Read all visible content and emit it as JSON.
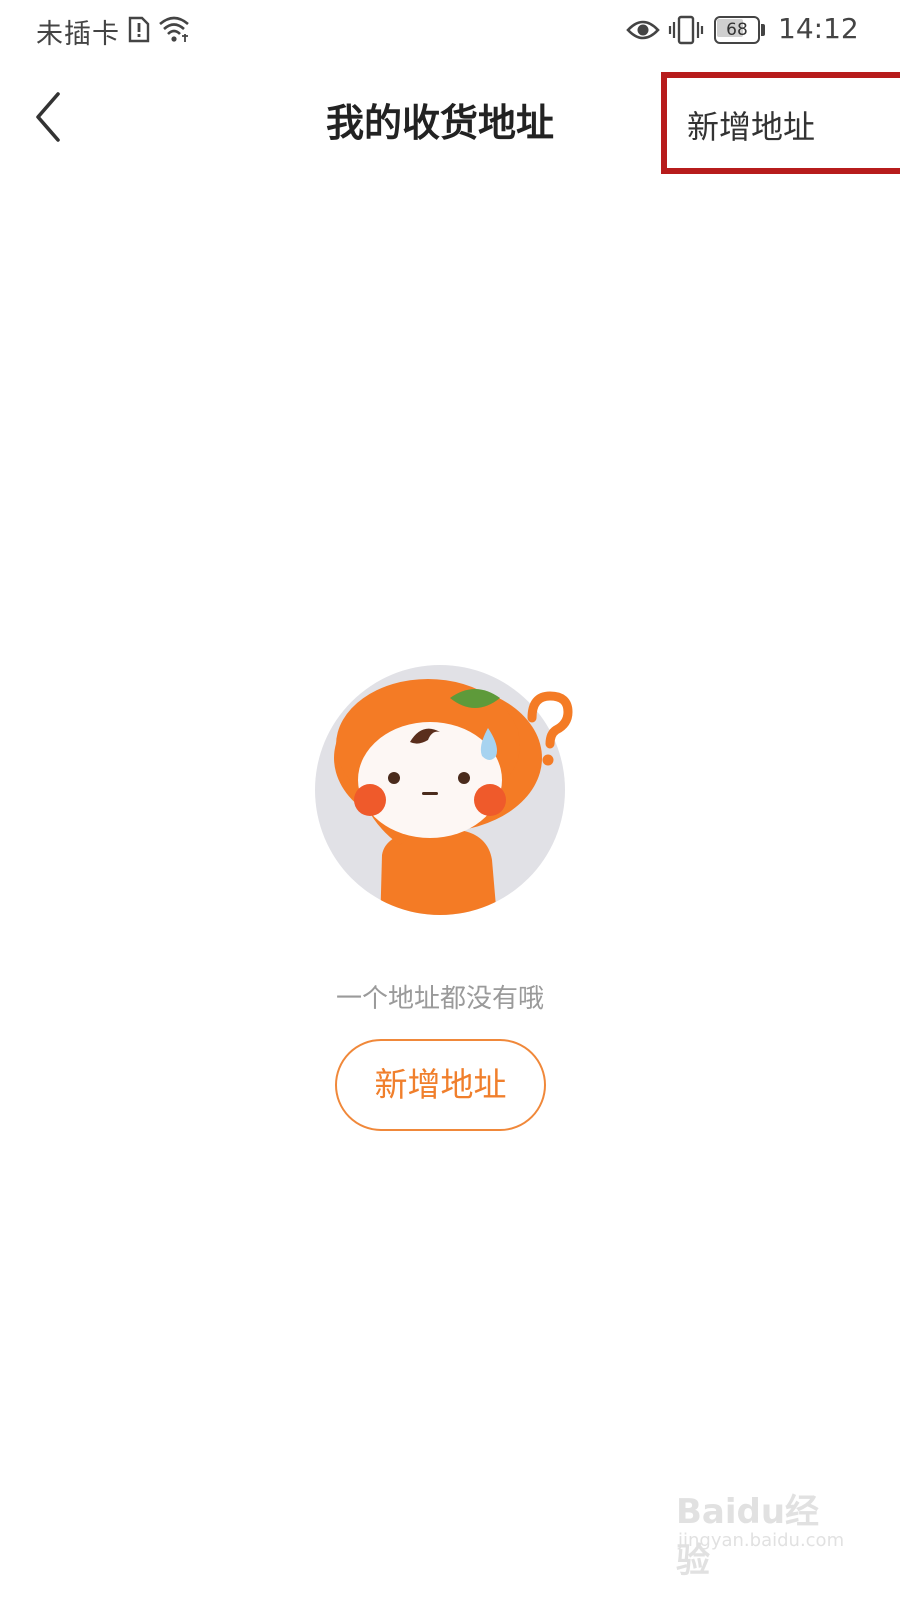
{
  "status_bar": {
    "carrier": "未插卡",
    "battery_level": "68",
    "time": "14:12",
    "icons": [
      "sim-alert-icon",
      "wifi-icon",
      "eye-icon",
      "vibrate-icon",
      "battery-icon"
    ]
  },
  "nav": {
    "back_icon": "chevron-left-icon",
    "title": "我的收货地址",
    "action_label": "新增地址",
    "highlight_color": "#b71c1c"
  },
  "empty_state": {
    "illustration": "confused-orange-mascot",
    "message": "一个地址都没有哦",
    "button_label": "新增地址",
    "accent_color": "#f07f2c"
  },
  "watermark": {
    "brand": "Baidu经验",
    "url": "jingyan.baidu.com"
  }
}
